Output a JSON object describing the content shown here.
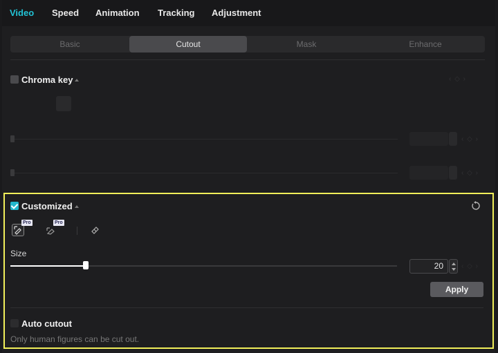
{
  "top_tabs": [
    {
      "label": "Video",
      "active": true
    },
    {
      "label": "Speed"
    },
    {
      "label": "Animation"
    },
    {
      "label": "Tracking"
    },
    {
      "label": "Adjustment"
    }
  ],
  "sub_tabs": [
    {
      "label": "Basic"
    },
    {
      "label": "Cutout",
      "active": true
    },
    {
      "label": "Mask"
    },
    {
      "label": "Enhance"
    }
  ],
  "chroma_key": {
    "label": "Chroma key",
    "checked": false
  },
  "customized": {
    "label": "Customized",
    "checked": true,
    "tools": [
      {
        "icon": "smart-brush-icon",
        "badge": "Pro",
        "selected": true
      },
      {
        "icon": "smart-eraser-icon",
        "badge": "Pro"
      },
      {
        "icon": "eraser-icon"
      }
    ],
    "size_label": "Size",
    "size_value": "20",
    "size_fraction": 0.195,
    "apply_label": "Apply"
  },
  "auto_cutout": {
    "label": "Auto cutout",
    "checked": false,
    "hint": "Only human figures can be cut out."
  },
  "colors": {
    "accent": "#22c3d6",
    "highlight": "#f2f05a"
  }
}
